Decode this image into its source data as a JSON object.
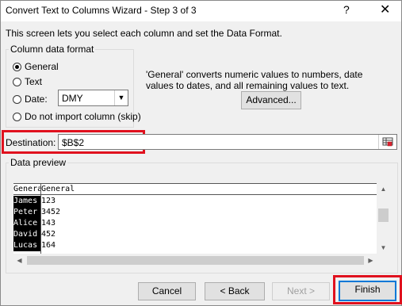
{
  "window": {
    "title": "Convert Text to Columns Wizard - Step 3 of 3",
    "help_label": "?",
    "close_label": "✕"
  },
  "intro_text": "This screen lets you select each column and set the Data Format.",
  "column_format": {
    "legend": "Column data format",
    "options": [
      {
        "label": "General",
        "checked": true
      },
      {
        "label": "Text",
        "checked": false
      },
      {
        "label": "Date:",
        "checked": false
      },
      {
        "label": "Do not import column (skip)",
        "checked": false
      }
    ],
    "date_value": "DMY",
    "date_arrow": "▼"
  },
  "general_description": "'General' converts numeric values to numbers, date values to dates, and all remaining values to text.",
  "advanced_button": "Advanced...",
  "destination": {
    "label": "Destination:",
    "value": "$B$2"
  },
  "preview": {
    "legend": "Data preview",
    "headers": [
      "General",
      "General"
    ],
    "rows": [
      [
        "James",
        "123"
      ],
      [
        "Peter",
        "3452"
      ],
      [
        "Alice",
        "143"
      ],
      [
        "David",
        "452"
      ],
      [
        "Lucas",
        "164"
      ]
    ]
  },
  "buttons": {
    "cancel": "Cancel",
    "back": "< Back",
    "next": "Next >",
    "finish": "Finish"
  },
  "colors": {
    "highlight": "#e0111e",
    "focus": "#0078d7"
  }
}
